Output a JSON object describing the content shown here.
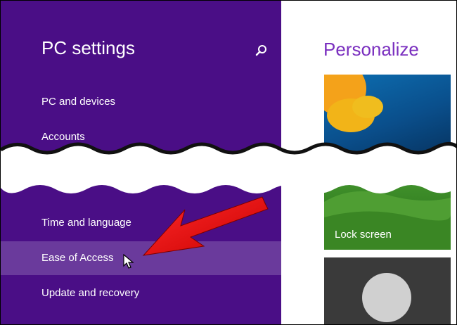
{
  "sidebar": {
    "title": "PC settings",
    "items": [
      {
        "label": "PC and devices"
      },
      {
        "label": "Accounts"
      },
      {
        "label": "Time and language"
      },
      {
        "label": "Ease of Access"
      },
      {
        "label": "Update and recovery"
      }
    ],
    "search_icon": "search-icon"
  },
  "main": {
    "title": "Personalize",
    "tiles": [
      {
        "label": ""
      },
      {
        "label": "Lock screen"
      },
      {
        "label": ""
      }
    ]
  },
  "colors": {
    "sidebar_bg": "#4a0e86",
    "selected_bg": "#6a3a9c",
    "accent_title": "#7a2fbf",
    "arrow": "#e00000"
  }
}
